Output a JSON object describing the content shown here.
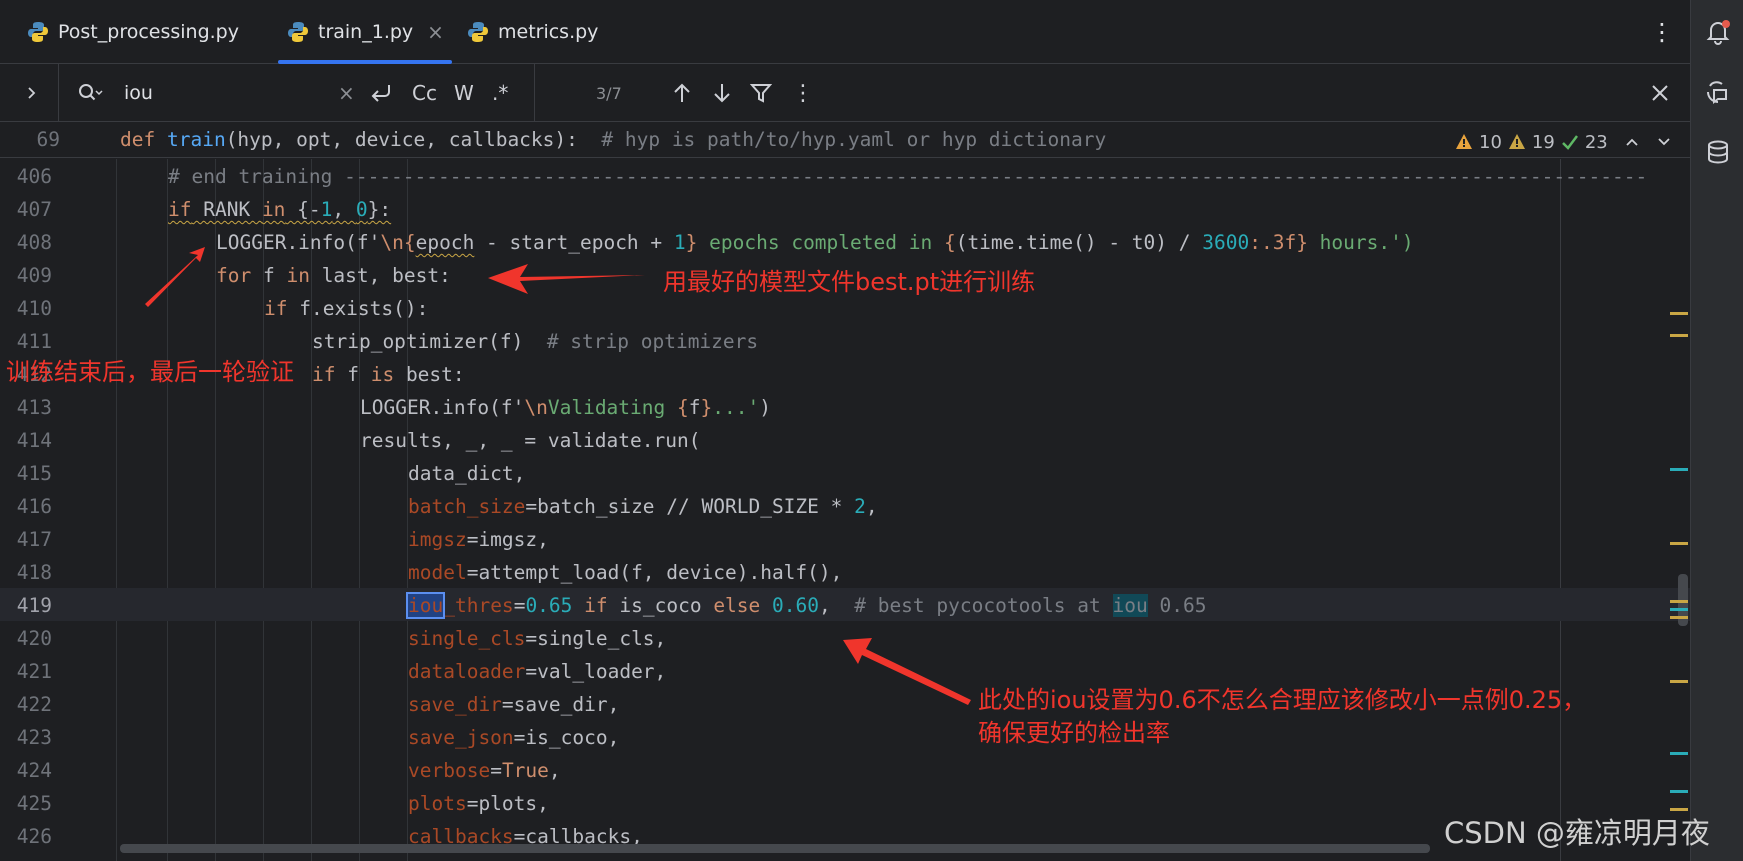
{
  "tabs": [
    {
      "label": "Post_processing.py",
      "active": false
    },
    {
      "label": "train_1.py",
      "active": true,
      "close": "×"
    },
    {
      "label": "metrics.py",
      "active": false
    }
  ],
  "find": {
    "query": "iou",
    "match_case_label": "Cc",
    "words_label": "W",
    "regex_label": ".*",
    "result_count": "3/7"
  },
  "sticky": {
    "line_number": "69",
    "code_def": "def",
    "code_fn": "train",
    "code_rest": "(hyp, opt, device, callbacks):  ",
    "code_comment": "# hyp is path/to/hyp.yaml or hyp dictionary"
  },
  "inspections": {
    "warnings": "10",
    "weak_warnings": "19",
    "ok": "23"
  },
  "line_numbers": [
    "406",
    "407",
    "408",
    "409",
    "410",
    "411",
    "412",
    "413",
    "414",
    "415",
    "416",
    "417",
    "418",
    "419",
    "420",
    "421",
    "422",
    "423",
    "424",
    "425",
    "426"
  ],
  "code": {
    "l406": "# end training ---------------------------------------------------------------------------------------------------------------",
    "l407_a": "if",
    "l407_b": " RANK ",
    "l407_c": "in",
    "l407_d": " {-",
    "l407_e": "1",
    "l407_f": ", ",
    "l407_g": "0",
    "l407_h": "}:",
    "l408_a": "LOGGER.info(f'",
    "l408_b": "\\n",
    "l408_c": "{",
    "l408_d": "epoch",
    "l408_e": " - start_epoch + ",
    "l408_f": "1",
    "l408_g": "}",
    "l408_h": " epochs completed in ",
    "l408_i": "{",
    "l408_j": "(time.time() - t0) / ",
    "l408_k": "3600",
    "l408_l": ":.3f",
    "l408_m": "}",
    "l408_n": " hours.')",
    "l409_a": "for",
    "l409_b": " f ",
    "l409_c": "in",
    "l409_d": " last, best:",
    "l410_a": "if",
    "l410_b": " f.exists():",
    "l411_a": "strip_optimizer(f)  ",
    "l411_b": "# strip optimizers",
    "l412_a": "if",
    "l412_b": " f ",
    "l412_c": "is",
    "l412_d": " best:",
    "l413_a": "LOGGER.info(f'",
    "l413_b": "\\n",
    "l413_c": "Validating ",
    "l413_d": "{",
    "l413_e": "f",
    "l413_f": "}",
    "l413_g": "...'",
    "l413_h": ")",
    "l414": "results, _, _ = validate.run(",
    "l415": "data_dict,",
    "l416_a": "batch_size",
    "l416_b": "=batch_size // WORLD_SIZE * ",
    "l416_c": "2",
    "l416_d": ",",
    "l417_a": "imgsz",
    "l417_b": "=imgsz,",
    "l418_a": "model",
    "l418_b": "=attempt_load(f, device).half(),",
    "l419_a": "iou",
    "l419_b": "_thres",
    "l419_c": "=",
    "l419_d": "0.65",
    "l419_e": " if",
    "l419_f": " is_coco ",
    "l419_g": "else",
    "l419_h": " 0.60",
    "l419_i": ",  ",
    "l419_j": "# best pycocotools at ",
    "l419_k": "iou",
    "l419_l": " 0.65",
    "l420_a": "single_cls",
    "l420_b": "=single_cls,",
    "l421_a": "dataloader",
    "l421_b": "=val_loader,",
    "l422_a": "save_dir",
    "l422_b": "=save_dir,",
    "l423_a": "save_json",
    "l423_b": "=is_coco,",
    "l424_a": "verbose",
    "l424_b": "=",
    "l424_c": "True",
    "l424_d": ",",
    "l425_a": "plots",
    "l425_b": "=plots,",
    "l426_a": "callbacks",
    "l426_b": "=callbacks,"
  },
  "annotations": {
    "best_model": "用最好的模型文件best.pt进行训练",
    "final_validation": "训练结束后，最后一轮验证",
    "iou_note_line1": "此处的iou设置为0.6不怎么合理应该修改小一点例0.25，",
    "iou_note_line2": "确保更好的检出率"
  },
  "watermark": "CSDN @雍凉明月夜",
  "colors": {
    "accent": "#3574f0",
    "annotation": "#f0352c",
    "background": "#1e1f22"
  }
}
